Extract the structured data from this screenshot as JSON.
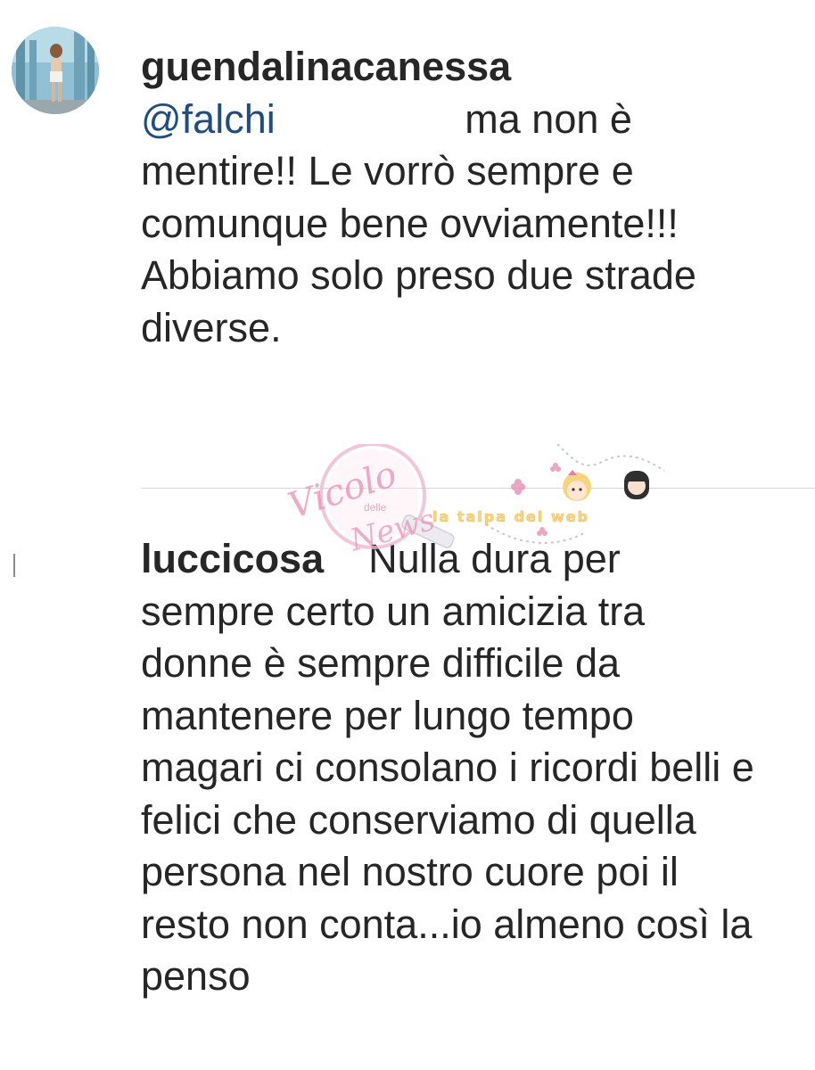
{
  "comments": [
    {
      "username": "guendalinacanessa",
      "mention": "@falchi",
      "text_after_mention": "                 ma non è mentire!! Le vorrò sempre e comunque bene ovviamente!!! Abbiamo solo preso due strade diverse."
    },
    {
      "username": "luccicosa",
      "text": "    Nulla dura per sempre certo un amicizia tra donne è sempre difficile da mantenere per lungo tempo magari ci consolano i ricordi belli e felici che conserviamo di quella persona nel nostro cuore poi il resto non conta...io almeno così la penso"
    }
  ],
  "watermark": {
    "script_line1": "Vicolo",
    "script_line2": "delle",
    "script_line3": "News",
    "tagline": "la talpa del web"
  },
  "colors": {
    "text": "#262626",
    "mention": "#1f4d7e",
    "divider": "#d6d6d6",
    "watermark_pink": "#e78fb3",
    "watermark_yellow": "#f3d27a"
  },
  "icons": {
    "avatar": "profile-photo-avatar",
    "watermark_logo": "watermark-logo"
  }
}
